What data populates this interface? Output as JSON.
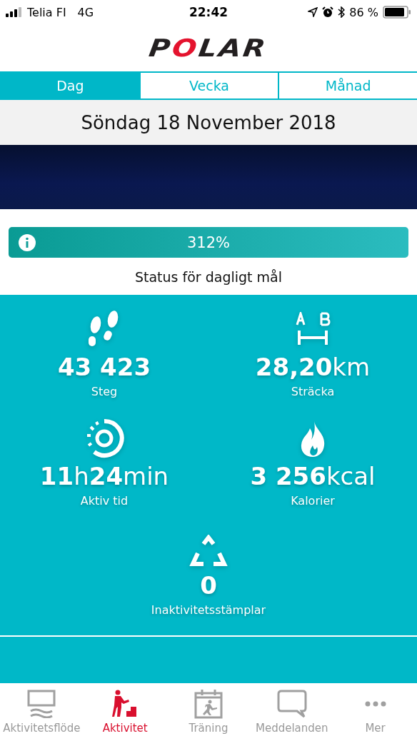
{
  "status_bar": {
    "carrier": "Telia FI",
    "network": "4G",
    "time": "22:42",
    "battery": "86 %"
  },
  "logo": "POLAR",
  "tabs": [
    {
      "label": "Dag",
      "selected": true
    },
    {
      "label": "Vecka",
      "selected": false
    },
    {
      "label": "Månad",
      "selected": false
    }
  ],
  "date": "Söndag 18 November 2018",
  "goal": {
    "level": 1,
    "reading": "312%",
    "label": "Status för dagligt mål"
  },
  "stats": [
    {
      "kind": "steps",
      "value": "43 423",
      "label": "Steg"
    },
    {
      "kind": "distance",
      "value": "28,20",
      "unit": "km",
      "label": "Sträcka"
    },
    {
      "kind": "time",
      "value": "11",
      "unit": "h",
      "value2": "24",
      "unit2": "min",
      "label": "Aktiv tid"
    },
    {
      "kind": "calories",
      "value": "3 256",
      "unit": "kcal",
      "label": "Kalorier"
    },
    {
      "kind": "inactivity",
      "value": "0",
      "label": "Inaktivitetsstämplar"
    }
  ],
  "nav": [
    {
      "kind": "feed",
      "label": "Aktivitetsflöde",
      "selected": false
    },
    {
      "kind": "activity",
      "label": "Aktivitet",
      "selected": true
    },
    {
      "kind": "training",
      "label": "Träning",
      "selected": false
    },
    {
      "kind": "messages",
      "label": "Meddelanden",
      "selected": false
    },
    {
      "kind": "more",
      "label": "Mer",
      "selected": false
    }
  ]
}
